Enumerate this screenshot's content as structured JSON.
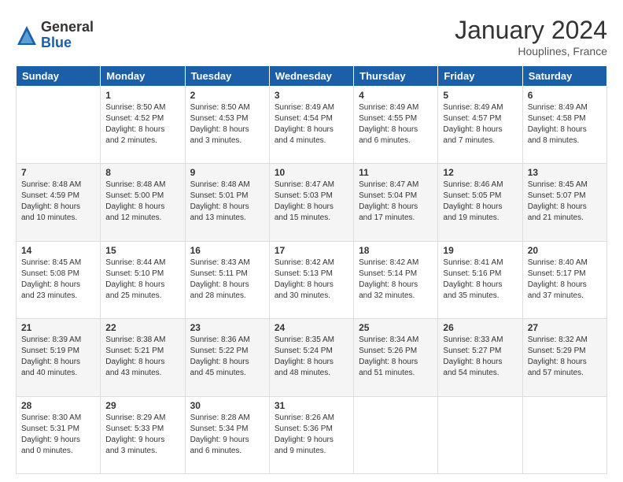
{
  "logo": {
    "general": "General",
    "blue": "Blue"
  },
  "header": {
    "title": "January 2024",
    "subtitle": "Houplines, France"
  },
  "days_of_week": [
    "Sunday",
    "Monday",
    "Tuesday",
    "Wednesday",
    "Thursday",
    "Friday",
    "Saturday"
  ],
  "weeks": [
    [
      {
        "day": "",
        "sunrise": "",
        "sunset": "",
        "daylight": ""
      },
      {
        "day": "1",
        "sunrise": "Sunrise: 8:50 AM",
        "sunset": "Sunset: 4:52 PM",
        "daylight": "Daylight: 8 hours and 2 minutes."
      },
      {
        "day": "2",
        "sunrise": "Sunrise: 8:50 AM",
        "sunset": "Sunset: 4:53 PM",
        "daylight": "Daylight: 8 hours and 3 minutes."
      },
      {
        "day": "3",
        "sunrise": "Sunrise: 8:49 AM",
        "sunset": "Sunset: 4:54 PM",
        "daylight": "Daylight: 8 hours and 4 minutes."
      },
      {
        "day": "4",
        "sunrise": "Sunrise: 8:49 AM",
        "sunset": "Sunset: 4:55 PM",
        "daylight": "Daylight: 8 hours and 6 minutes."
      },
      {
        "day": "5",
        "sunrise": "Sunrise: 8:49 AM",
        "sunset": "Sunset: 4:57 PM",
        "daylight": "Daylight: 8 hours and 7 minutes."
      },
      {
        "day": "6",
        "sunrise": "Sunrise: 8:49 AM",
        "sunset": "Sunset: 4:58 PM",
        "daylight": "Daylight: 8 hours and 8 minutes."
      }
    ],
    [
      {
        "day": "7",
        "sunrise": "Sunrise: 8:48 AM",
        "sunset": "Sunset: 4:59 PM",
        "daylight": "Daylight: 8 hours and 10 minutes."
      },
      {
        "day": "8",
        "sunrise": "Sunrise: 8:48 AM",
        "sunset": "Sunset: 5:00 PM",
        "daylight": "Daylight: 8 hours and 12 minutes."
      },
      {
        "day": "9",
        "sunrise": "Sunrise: 8:48 AM",
        "sunset": "Sunset: 5:01 PM",
        "daylight": "Daylight: 8 hours and 13 minutes."
      },
      {
        "day": "10",
        "sunrise": "Sunrise: 8:47 AM",
        "sunset": "Sunset: 5:03 PM",
        "daylight": "Daylight: 8 hours and 15 minutes."
      },
      {
        "day": "11",
        "sunrise": "Sunrise: 8:47 AM",
        "sunset": "Sunset: 5:04 PM",
        "daylight": "Daylight: 8 hours and 17 minutes."
      },
      {
        "day": "12",
        "sunrise": "Sunrise: 8:46 AM",
        "sunset": "Sunset: 5:05 PM",
        "daylight": "Daylight: 8 hours and 19 minutes."
      },
      {
        "day": "13",
        "sunrise": "Sunrise: 8:45 AM",
        "sunset": "Sunset: 5:07 PM",
        "daylight": "Daylight: 8 hours and 21 minutes."
      }
    ],
    [
      {
        "day": "14",
        "sunrise": "Sunrise: 8:45 AM",
        "sunset": "Sunset: 5:08 PM",
        "daylight": "Daylight: 8 hours and 23 minutes."
      },
      {
        "day": "15",
        "sunrise": "Sunrise: 8:44 AM",
        "sunset": "Sunset: 5:10 PM",
        "daylight": "Daylight: 8 hours and 25 minutes."
      },
      {
        "day": "16",
        "sunrise": "Sunrise: 8:43 AM",
        "sunset": "Sunset: 5:11 PM",
        "daylight": "Daylight: 8 hours and 28 minutes."
      },
      {
        "day": "17",
        "sunrise": "Sunrise: 8:42 AM",
        "sunset": "Sunset: 5:13 PM",
        "daylight": "Daylight: 8 hours and 30 minutes."
      },
      {
        "day": "18",
        "sunrise": "Sunrise: 8:42 AM",
        "sunset": "Sunset: 5:14 PM",
        "daylight": "Daylight: 8 hours and 32 minutes."
      },
      {
        "day": "19",
        "sunrise": "Sunrise: 8:41 AM",
        "sunset": "Sunset: 5:16 PM",
        "daylight": "Daylight: 8 hours and 35 minutes."
      },
      {
        "day": "20",
        "sunrise": "Sunrise: 8:40 AM",
        "sunset": "Sunset: 5:17 PM",
        "daylight": "Daylight: 8 hours and 37 minutes."
      }
    ],
    [
      {
        "day": "21",
        "sunrise": "Sunrise: 8:39 AM",
        "sunset": "Sunset: 5:19 PM",
        "daylight": "Daylight: 8 hours and 40 minutes."
      },
      {
        "day": "22",
        "sunrise": "Sunrise: 8:38 AM",
        "sunset": "Sunset: 5:21 PM",
        "daylight": "Daylight: 8 hours and 43 minutes."
      },
      {
        "day": "23",
        "sunrise": "Sunrise: 8:36 AM",
        "sunset": "Sunset: 5:22 PM",
        "daylight": "Daylight: 8 hours and 45 minutes."
      },
      {
        "day": "24",
        "sunrise": "Sunrise: 8:35 AM",
        "sunset": "Sunset: 5:24 PM",
        "daylight": "Daylight: 8 hours and 48 minutes."
      },
      {
        "day": "25",
        "sunrise": "Sunrise: 8:34 AM",
        "sunset": "Sunset: 5:26 PM",
        "daylight": "Daylight: 8 hours and 51 minutes."
      },
      {
        "day": "26",
        "sunrise": "Sunrise: 8:33 AM",
        "sunset": "Sunset: 5:27 PM",
        "daylight": "Daylight: 8 hours and 54 minutes."
      },
      {
        "day": "27",
        "sunrise": "Sunrise: 8:32 AM",
        "sunset": "Sunset: 5:29 PM",
        "daylight": "Daylight: 8 hours and 57 minutes."
      }
    ],
    [
      {
        "day": "28",
        "sunrise": "Sunrise: 8:30 AM",
        "sunset": "Sunset: 5:31 PM",
        "daylight": "Daylight: 9 hours and 0 minutes."
      },
      {
        "day": "29",
        "sunrise": "Sunrise: 8:29 AM",
        "sunset": "Sunset: 5:33 PM",
        "daylight": "Daylight: 9 hours and 3 minutes."
      },
      {
        "day": "30",
        "sunrise": "Sunrise: 8:28 AM",
        "sunset": "Sunset: 5:34 PM",
        "daylight": "Daylight: 9 hours and 6 minutes."
      },
      {
        "day": "31",
        "sunrise": "Sunrise: 8:26 AM",
        "sunset": "Sunset: 5:36 PM",
        "daylight": "Daylight: 9 hours and 9 minutes."
      },
      {
        "day": "",
        "sunrise": "",
        "sunset": "",
        "daylight": ""
      },
      {
        "day": "",
        "sunrise": "",
        "sunset": "",
        "daylight": ""
      },
      {
        "day": "",
        "sunrise": "",
        "sunset": "",
        "daylight": ""
      }
    ]
  ]
}
